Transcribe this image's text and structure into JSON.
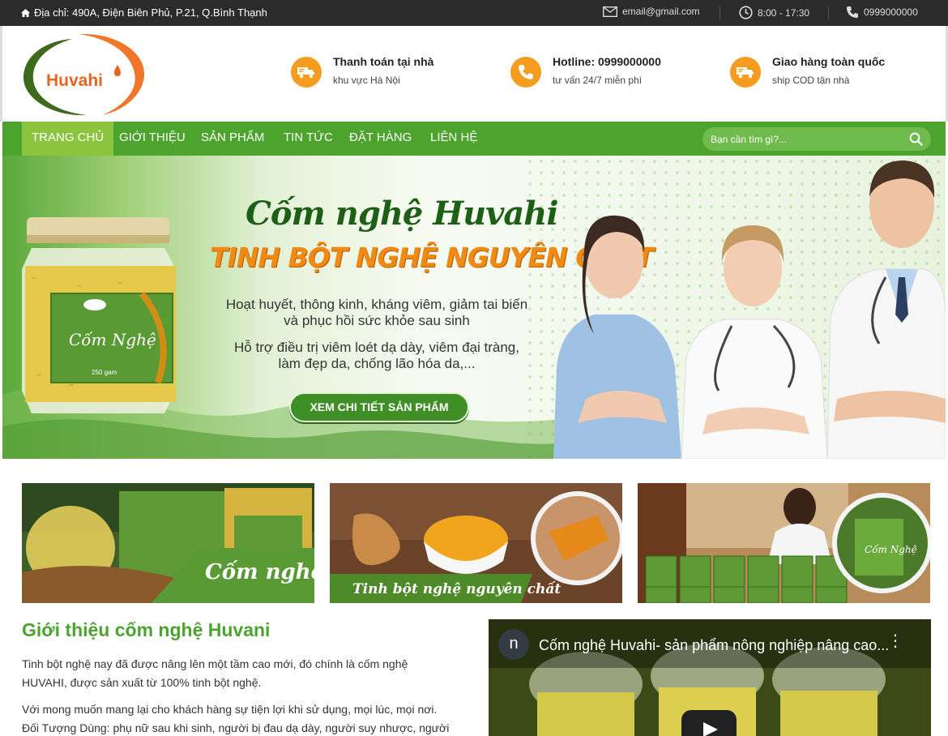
{
  "topbar": {
    "address": "Địa chỉ: 490A, Điện Biên Phủ, P.21, Q.Bình Thạnh",
    "email": "email@gmail.com",
    "hours": "8:00 - 17:30",
    "phone": "0999000000"
  },
  "header": {
    "logo_text": "Huvahi",
    "features": [
      {
        "title": "Thanh toán tại nhà",
        "subtitle": "khu vực Hà Nội",
        "icon": "truck-icon"
      },
      {
        "title": "Hotline: 0999000000",
        "subtitle": "tư vấn 24/7 miễn phí",
        "icon": "phone-icon"
      },
      {
        "title": "Giao hàng toàn quốc",
        "subtitle": "ship COD tận nhà",
        "icon": "truck-icon"
      }
    ]
  },
  "nav": {
    "items": [
      "TRANG CHỦ",
      "GIỚI THIỆU",
      "SẢN PHẨM",
      "TIN TỨC",
      "ĐẶT HÀNG",
      "LIÊN HỆ"
    ],
    "active": "TRANG CHỦ",
    "search_placeholder": "Bạn cần tìm gì?..."
  },
  "banner": {
    "title": "Cốm nghệ Huvahi",
    "subtitle": "TINH BỘT NGHỆ NGUYÊN CHẤT",
    "lines": [
      "Hoạt huyết, thông kinh, kháng viêm, giảm tai biến",
      "và phục hồi sức khỏe sau sinh",
      "Hỗ trợ điều trị viêm loét dạ dày, viêm đại tràng,",
      "làm đẹp da, chống lão hóa da,..."
    ],
    "cta": "XEM CHI TIẾT SẢN PHẨM",
    "jar_label": "Cốm Nghệ",
    "jar_weight": "250 gam"
  },
  "thumbs": [
    {
      "caption": "Cốm nghệ"
    },
    {
      "caption": "Tinh bột nghệ nguyên chất"
    },
    {
      "caption": "Cốm Nghệ"
    }
  ],
  "intro": {
    "title": "Giới thiệu cốm nghệ Huvani",
    "paragraphs": [
      "Tinh bột nghệ nay đã được nâng lên một tầm cao mới, đó chính là cốm nghệ",
      "HUVAHI, được sản xuất từ 100% tinh bột nghệ.",
      "Với mong muốn mang lại cho khách hàng sự tiện lợi khi sử dụng, mọi lúc, mọi nơi.",
      "Đối Tượng Dùng: phụ nữ sau khi sinh, người bị đau dạ dày, người suy nhược, người"
    ]
  },
  "video": {
    "channel_initial": "n",
    "title": "Cốm nghệ Huvahi- sản phẩm nông nghiệp nâng cao..."
  },
  "colors": {
    "topbar": "#2b2b2b",
    "nav": "#4ca32e",
    "nav_active": "#8bc53f",
    "accent_orange": "#f39c1f",
    "title_green": "#4ca32e"
  }
}
